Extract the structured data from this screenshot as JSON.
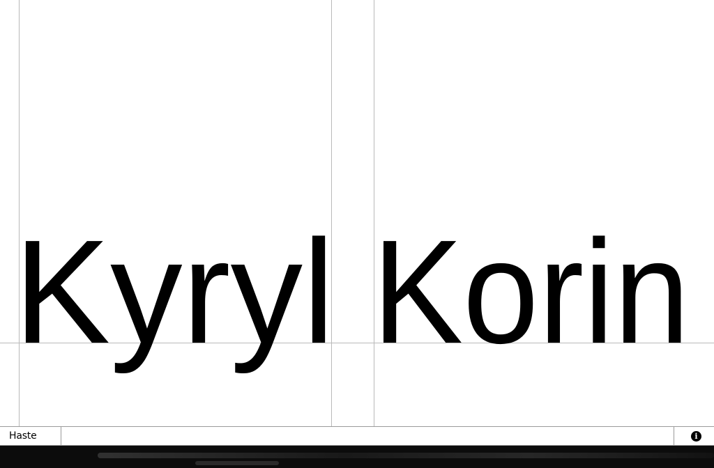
{
  "hero": {
    "first_name": "Kyryl",
    "last_name": "Korin"
  },
  "footer": {
    "label": "Haste",
    "info_icon": "info-icon",
    "info_glyph": "i"
  },
  "colors": {
    "background": "#ffffff",
    "text": "#000000",
    "guides": "#b9b9b9",
    "media_strip": "#0c0c0c"
  }
}
